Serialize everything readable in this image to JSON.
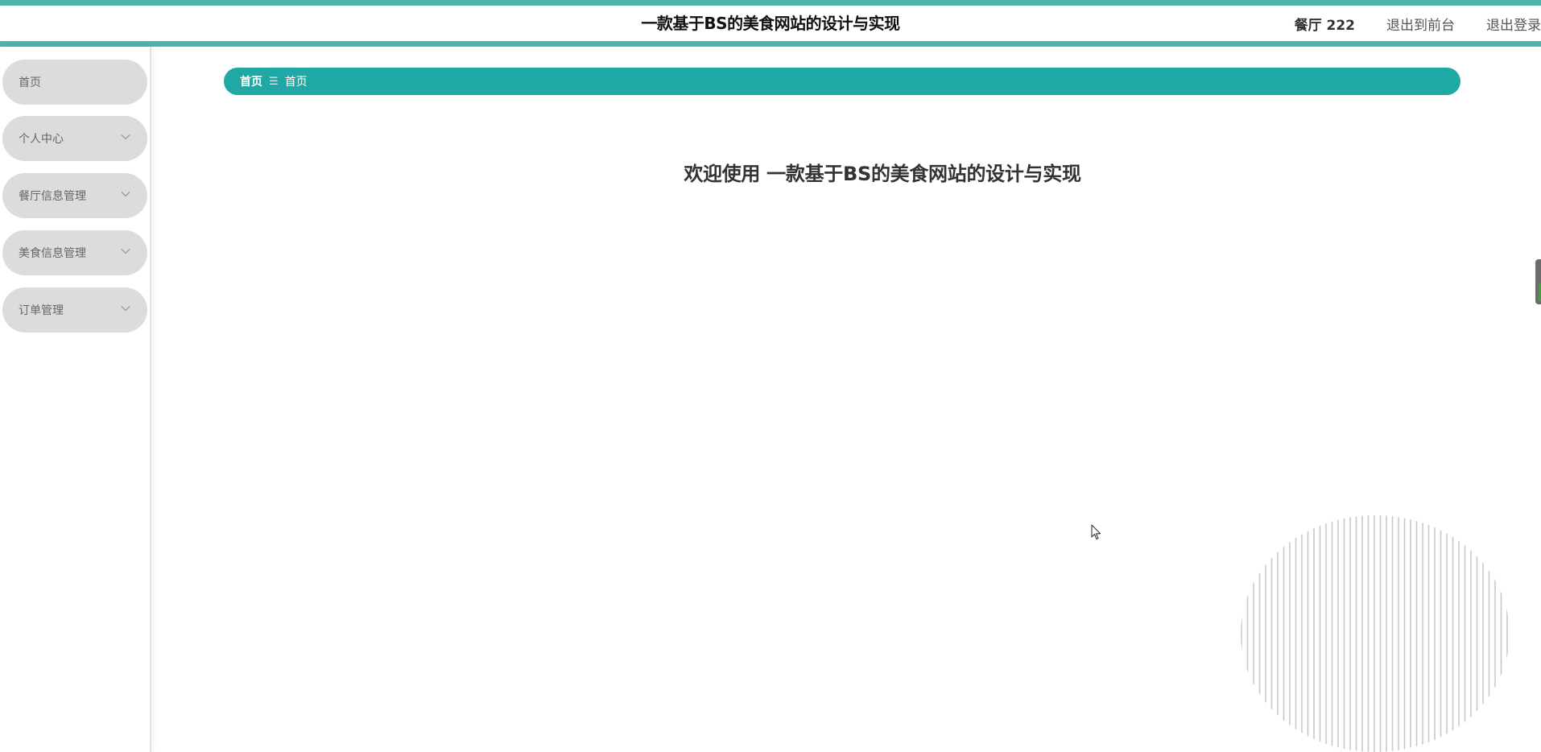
{
  "header": {
    "title": "一款基于BS的美食网站的设计与实现",
    "user_label": "餐厅 222",
    "front_link": "退出到前台",
    "logout_link": "退出登录"
  },
  "sidebar": {
    "items": [
      {
        "label": "首页",
        "has_submenu": false
      },
      {
        "label": "个人中心",
        "has_submenu": true
      },
      {
        "label": "餐厅信息管理",
        "has_submenu": true
      },
      {
        "label": "美食信息管理",
        "has_submenu": true
      },
      {
        "label": "订单管理",
        "has_submenu": true
      }
    ]
  },
  "breadcrumb": {
    "items": [
      "首页",
      "首页"
    ],
    "separator": "☰"
  },
  "main": {
    "welcome": "欢迎使用 一款基于BS的美食网站的设计与实现"
  },
  "colors": {
    "accent": "#4db3ab",
    "breadcrumb_bg": "#1fa8a4",
    "menu_bg": "#dcdcdc",
    "menu_text": "#666666",
    "title_text": "#111111"
  },
  "icons": {
    "menu_expand": "chevron-down-icon",
    "breadcrumb_sep": "menu-lines-icon",
    "decoration": "striped-circle-decoration",
    "cursor": "mouse-pointer-icon"
  }
}
